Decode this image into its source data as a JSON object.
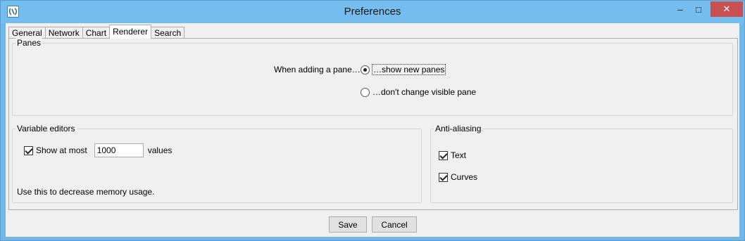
{
  "window": {
    "title": "Preferences",
    "controls": {
      "minimize": "–",
      "maximize": "□",
      "close": "✕"
    }
  },
  "tabs": [
    {
      "label": "General",
      "active": false
    },
    {
      "label": "Network",
      "active": false
    },
    {
      "label": "Chart",
      "active": false
    },
    {
      "label": "Renderer",
      "active": true
    },
    {
      "label": "Search",
      "active": false
    }
  ],
  "panes": {
    "title": "Panes",
    "prompt": "When adding a pane…",
    "options": [
      {
        "label": "…show new panes",
        "selected": true
      },
      {
        "label": "…don't change visible pane",
        "selected": false
      }
    ]
  },
  "variable_editors": {
    "title": "Variable editors",
    "show_at_most_label": "Show at most",
    "show_at_most_checked": true,
    "max_value": "1000",
    "unit_label": "values",
    "hint": "Use this to decrease memory usage."
  },
  "anti_aliasing": {
    "title": "Anti-aliasing",
    "text_label": "Text",
    "text_checked": true,
    "curves_label": "Curves",
    "curves_checked": true
  },
  "buttons": {
    "save": "Save",
    "cancel": "Cancel"
  },
  "colors": {
    "titlebar": "#74bdee",
    "close_button": "#c75050",
    "client_bg": "#f0f0f0"
  }
}
